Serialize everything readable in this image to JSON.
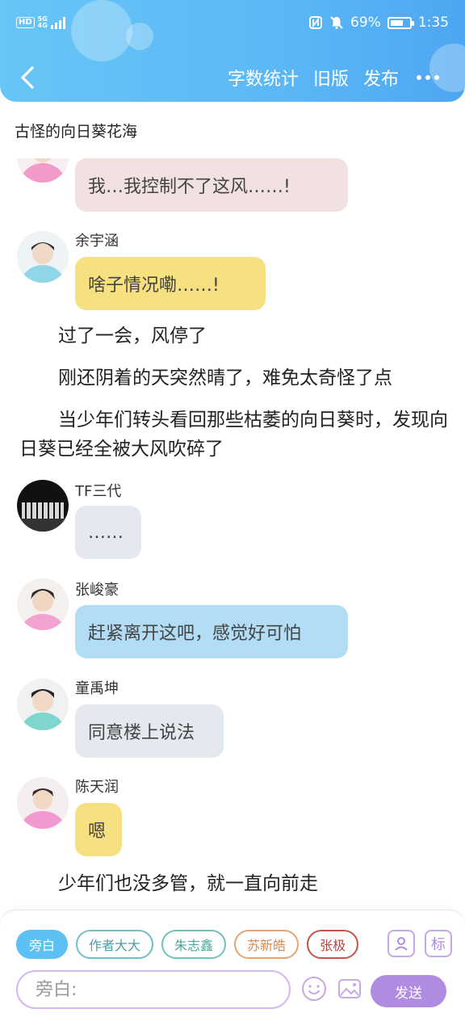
{
  "status_bar": {
    "hd": "HD",
    "network": "5G",
    "network_sub": "4G",
    "battery_text": "69%",
    "battery_level": 0.69,
    "time": "1:35"
  },
  "nav": {
    "back_icon": "chevron-left-icon",
    "actions": [
      "字数统计",
      "旧版",
      "发布"
    ],
    "more_icon": "more-dots-icon"
  },
  "story": {
    "title": "古怪的向日葵花海"
  },
  "colors": {
    "header_gradient": [
      "#67c6f6",
      "#4ea6f2"
    ],
    "bubble_pink": "#f2e1e1",
    "bubble_yellow": "#f7e07f",
    "bubble_gray": "#e4e9ef",
    "bubble_blue": "#b3dcf5",
    "accent_purple": "#b08be2",
    "chip_blue": "#5dc0f3"
  },
  "messages": [
    {
      "type": "dialog",
      "speaker": "",
      "avatar": "avatar-pink-shirt",
      "text": "我…我控制不了这风……!",
      "bubble_color": "pink"
    },
    {
      "type": "dialog",
      "speaker": "余宇涵",
      "avatar": "avatar-yu-yuhan",
      "text": "啥子情况嘞……!",
      "bubble_color": "yellow"
    },
    {
      "type": "narration",
      "text": "过了一会，风停了"
    },
    {
      "type": "narration",
      "text": "刚还阴着的天突然晴了，难免太奇怪了点"
    },
    {
      "type": "narration",
      "text": "当少年们转头看回那些枯萎的向日葵时，发现向日葵已经全被大风吹碎了"
    },
    {
      "type": "dialog",
      "speaker": "TF三代",
      "avatar": "avatar-tf-group",
      "text": "……",
      "bubble_color": "gray"
    },
    {
      "type": "dialog",
      "speaker": "张峻豪",
      "avatar": "avatar-zhang-junhao",
      "text": "赶紧离开这吧，感觉好可怕",
      "bubble_color": "blue"
    },
    {
      "type": "dialog",
      "speaker": "童禹坤",
      "avatar": "avatar-tong-yukun",
      "text": "同意楼上说法",
      "bubble_color": "gray"
    },
    {
      "type": "dialog",
      "speaker": "陈天润",
      "avatar": "avatar-chen-tianrun",
      "text": "嗯",
      "bubble_color": "yellow"
    },
    {
      "type": "narration",
      "text": "少年们也没多管，就一直向前走"
    }
  ],
  "composer": {
    "roles": [
      {
        "label": "旁白",
        "active": true,
        "color": "#5dc0f3"
      },
      {
        "label": "作者大大",
        "active": false,
        "color": "#6fbfc9"
      },
      {
        "label": "朱志鑫",
        "active": false,
        "color": "#6fc3b8"
      },
      {
        "label": "苏新皓",
        "active": false,
        "color": "#e8a470"
      },
      {
        "label": "张极",
        "active": false,
        "color": "#c9524a"
      }
    ],
    "role_manage_icon": "person-card-icon",
    "tag_icon": "tag-label-icon",
    "tag_label": "标",
    "placeholder": "旁白:",
    "emoji_icon": "smiley-icon",
    "image_icon": "image-icon",
    "send_label": "发送"
  }
}
